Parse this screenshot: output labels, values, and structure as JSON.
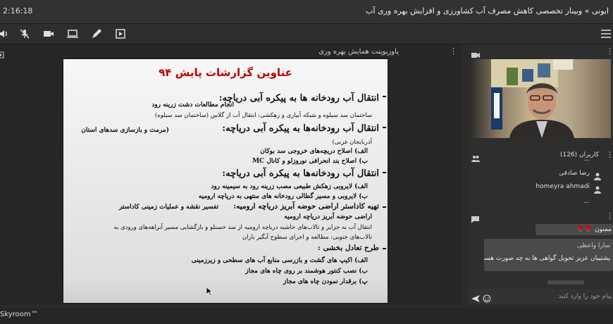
{
  "header": {
    "time": "2:16:18",
    "title": "ایونی » وبینار تخصصی کاهش مصرف آب کشاورزی و افزایش بهره وری آب"
  },
  "presentation": {
    "title": "پاورپوینت همایش بهره وری",
    "slide": {
      "heading": "عناوین گزارشات پایش ۹۴",
      "lines": [
        {
          "t": "انتقال آب رودخانه ها به پیکره آبی دریاچه:",
          "s": "h"
        },
        {
          "t": "انجام مطالعات دشت زرینه رود",
          "s": "s"
        },
        {
          "t": "ساختمان سد سیلوه و شبکه آبیاری و زهکشی: انتقال آب از گلاس (ساختمان سد سیلوه)",
          "s": "n"
        },
        {
          "t": "انتقال آب رودخانه‌ها به پیکره آبی دریاچه:",
          "s": "h"
        },
        {
          "t": "(مرمت و بازسازی سدهای استان",
          "s": "s"
        },
        {
          "t": "آذربایجان غربی)",
          "s": "n"
        },
        {
          "t": "الف) اصلاح دریچه‌های خروجی سد بوکان",
          "s": "s"
        },
        {
          "t": "ب) اصلاح بند انحرافی نوروزلو و کانال MC",
          "s": "s"
        },
        {
          "t": "انتقال آب رودخانه‌ها به پیکره آبی دریاچه:",
          "s": "h"
        },
        {
          "t": "الف) لایروبی زهکش طبیعی مصب زرینه رود به سیمینه رود",
          "s": "s"
        },
        {
          "t": "ب) لایروبی و مسیر گطالی رودخانه های منتهی به دریاچه ارومیه",
          "s": "s"
        },
        {
          "t": "تهیه کاداستر اراضی حوضه آبریز دریاچه ارومیه:",
          "s": "h2"
        },
        {
          "t": "تفسیر نقشه و عملیات زمینی کاداستر",
          "s": "s"
        },
        {
          "t": "اراضی حوضه آبریز دریاچه ارومیه",
          "s": "s"
        },
        {
          "t": "انتقال آب به جزایر و تالاب‌های حاشیه دریاچه ارومیه از سد حسنلو و بازگشایی مسیر آبراهه‌های ورودی به",
          "s": "n"
        },
        {
          "t": "تالاب‌های جنوبی: مطالعه و اجرای سطوح آبگیر باران",
          "s": "n"
        },
        {
          "t": "طرح تعادل بخشی :",
          "s": "h2"
        },
        {
          "t": "الف) اکیپ های گشت و بازرسی منابع آب های سطحی و زیرزمینی",
          "s": "s"
        },
        {
          "t": "ب) نصب کنتور هوشمند بر روی چاه های مجاز",
          "s": "s"
        },
        {
          "t": "پ) برقدار نمودن چاه های مجاز",
          "s": "s"
        }
      ]
    }
  },
  "users": {
    "header": "کاربران (126)",
    "list": [
      {
        "name": "..."
      },
      {
        "name": "رضا صادقی"
      },
      {
        "name": "homeyra ahmadi"
      },
      {
        "name": "..."
      }
    ]
  },
  "chat": {
    "messages": [
      {
        "text": "ممنون 🌹🌹"
      },
      {
        "author": "سارا واعظی",
        "text": "پشتیبان عزیز تحویل گواهی ها به چه صورت هست؟"
      }
    ],
    "input_placeholder": "پیام خود را وارد کنید"
  },
  "footer": {
    "brand": "Skyroom™"
  }
}
